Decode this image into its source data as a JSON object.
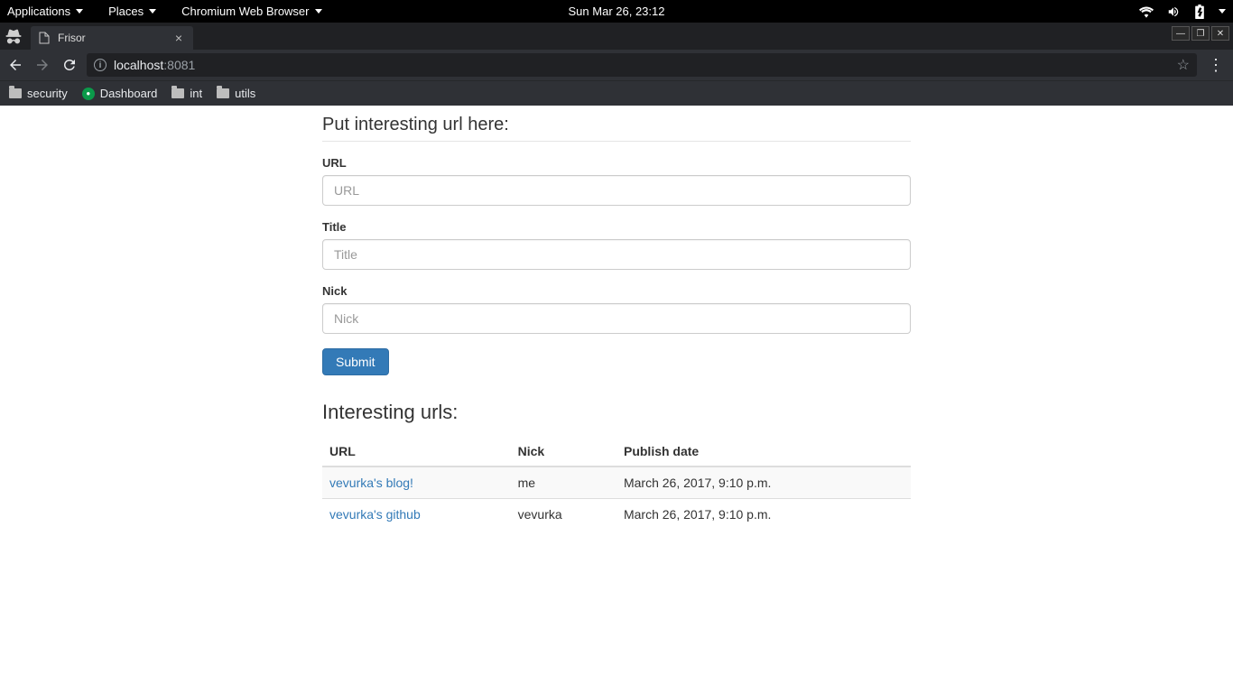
{
  "gnome": {
    "applications": "Applications",
    "places": "Places",
    "app": "Chromium Web Browser",
    "clock": "Sun Mar 26, 23:12"
  },
  "tab": {
    "title": "Frisor"
  },
  "url": {
    "host": "localhost",
    "port": ":8081"
  },
  "bookmarks": {
    "security": "security",
    "dashboard": "Dashboard",
    "int": "int",
    "utils": "utils"
  },
  "page": {
    "form_heading": "Put interesting url here:",
    "url_label": "URL",
    "url_placeholder": "URL",
    "title_label": "Title",
    "title_placeholder": "Title",
    "nick_label": "Nick",
    "nick_placeholder": "Nick",
    "submit": "Submit",
    "list_heading": "Interesting urls:",
    "columns": {
      "url": "URL",
      "nick": "Nick",
      "publish": "Publish date"
    },
    "rows": [
      {
        "title": "vevurka's blog!",
        "nick": "me",
        "publish": "March 26, 2017, 9:10 p.m."
      },
      {
        "title": "vevurka's github",
        "nick": "vevurka",
        "publish": "March 26, 2017, 9:10 p.m."
      }
    ]
  }
}
